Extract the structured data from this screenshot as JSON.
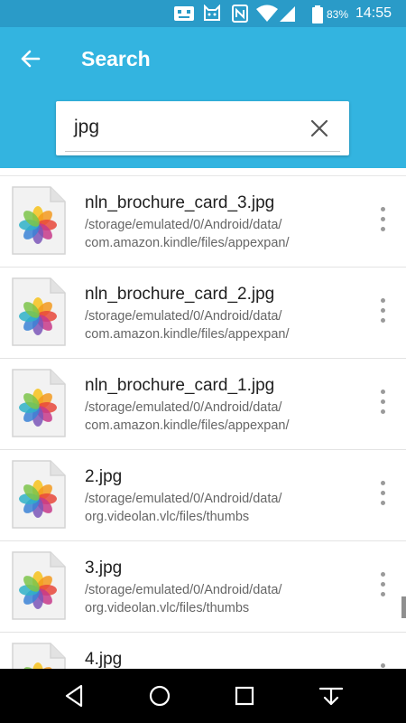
{
  "status_bar": {
    "battery_percent": "83%",
    "time": "14:55",
    "icons": [
      "robot-notification-icon",
      "cat-notification-icon",
      "nfc-icon",
      "wifi-icon",
      "signal-icon",
      "battery-icon"
    ]
  },
  "app_bar": {
    "title": "Search",
    "back_icon": "arrow-left-icon"
  },
  "search": {
    "query": "jpg",
    "clear_icon": "close-icon"
  },
  "results": [
    {
      "name": "nln_brochure_card_3.jpg",
      "path_line1": "/storage/emulated/0/Android/data/",
      "path_line2": "com.amazon.kindle/files/appexpan/"
    },
    {
      "name": "nln_brochure_card_2.jpg",
      "path_line1": "/storage/emulated/0/Android/data/",
      "path_line2": "com.amazon.kindle/files/appexpan/"
    },
    {
      "name": "nln_brochure_card_1.jpg",
      "path_line1": "/storage/emulated/0/Android/data/",
      "path_line2": "com.amazon.kindle/files/appexpan/"
    },
    {
      "name": "2.jpg",
      "path_line1": "/storage/emulated/0/Android/data/",
      "path_line2": "org.videolan.vlc/files/thumbs"
    },
    {
      "name": "3.jpg",
      "path_line1": "/storage/emulated/0/Android/data/",
      "path_line2": "org.videolan.vlc/files/thumbs"
    },
    {
      "name": "4.jpg",
      "path_line1": "",
      "path_line2": ""
    }
  ],
  "nav_bar": {
    "icons": [
      "back-triangle-icon",
      "home-circle-icon",
      "recents-square-icon",
      "notification-pulldown-icon"
    ]
  },
  "colors": {
    "status_bar": "#2a9bc8",
    "app_bar": "#33b4e0",
    "nav_bar": "#000000"
  }
}
